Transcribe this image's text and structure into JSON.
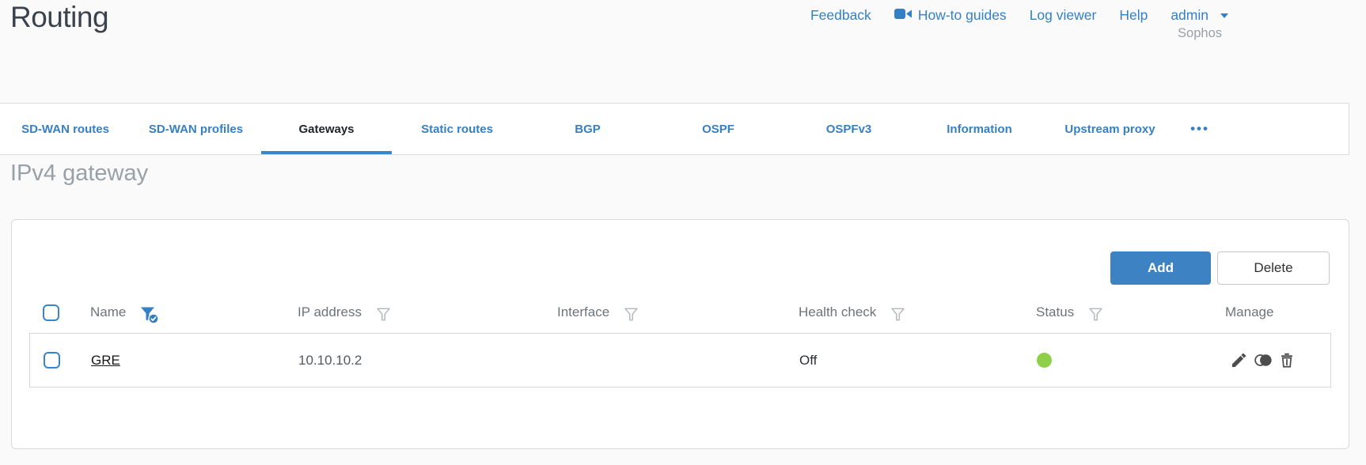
{
  "page": {
    "title": "Routing"
  },
  "header": {
    "links": [
      {
        "label": "Feedback"
      },
      {
        "label": "How-to guides",
        "icon": "video-camera-icon"
      },
      {
        "label": "Log viewer"
      },
      {
        "label": "Help"
      }
    ],
    "user_menu": {
      "label": "admin"
    },
    "brand": "Sophos"
  },
  "tabs": {
    "items": [
      {
        "label": "SD-WAN routes",
        "active": false
      },
      {
        "label": "SD-WAN profiles",
        "active": false
      },
      {
        "label": "Gateways",
        "active": true
      },
      {
        "label": "Static routes",
        "active": false
      },
      {
        "label": "BGP",
        "active": false
      },
      {
        "label": "OSPF",
        "active": false
      },
      {
        "label": "OSPFv3",
        "active": false
      },
      {
        "label": "Information",
        "active": false
      },
      {
        "label": "Upstream proxy",
        "active": false
      }
    ],
    "overflow_label": "•••"
  },
  "section": {
    "heading": "IPv4 gateway"
  },
  "toolbar": {
    "add_label": "Add",
    "delete_label": "Delete"
  },
  "table": {
    "columns": [
      {
        "label": "Name",
        "filter": "active"
      },
      {
        "label": "IP address",
        "filter": "inactive"
      },
      {
        "label": "Interface",
        "filter": "inactive"
      },
      {
        "label": "Health check",
        "filter": "inactive"
      },
      {
        "label": "Status",
        "filter": "inactive"
      },
      {
        "label": "Manage",
        "filter": "none"
      }
    ],
    "rows": [
      {
        "name": "GRE",
        "ip_address": "10.10.10.2",
        "interface": "",
        "health_check": "Off",
        "status": "up"
      }
    ]
  },
  "icons": {
    "howto": "video-camera-icon",
    "filter_active": "funnel-check-icon",
    "filter_inactive": "funnel-icon",
    "manage": [
      "pencil-icon",
      "clone-icon",
      "trash-icon"
    ],
    "status_up": "green-dot"
  },
  "colors": {
    "accent": "#3580c4",
    "button_blue": "#3d82c3",
    "status_green": "#8ed04a"
  }
}
